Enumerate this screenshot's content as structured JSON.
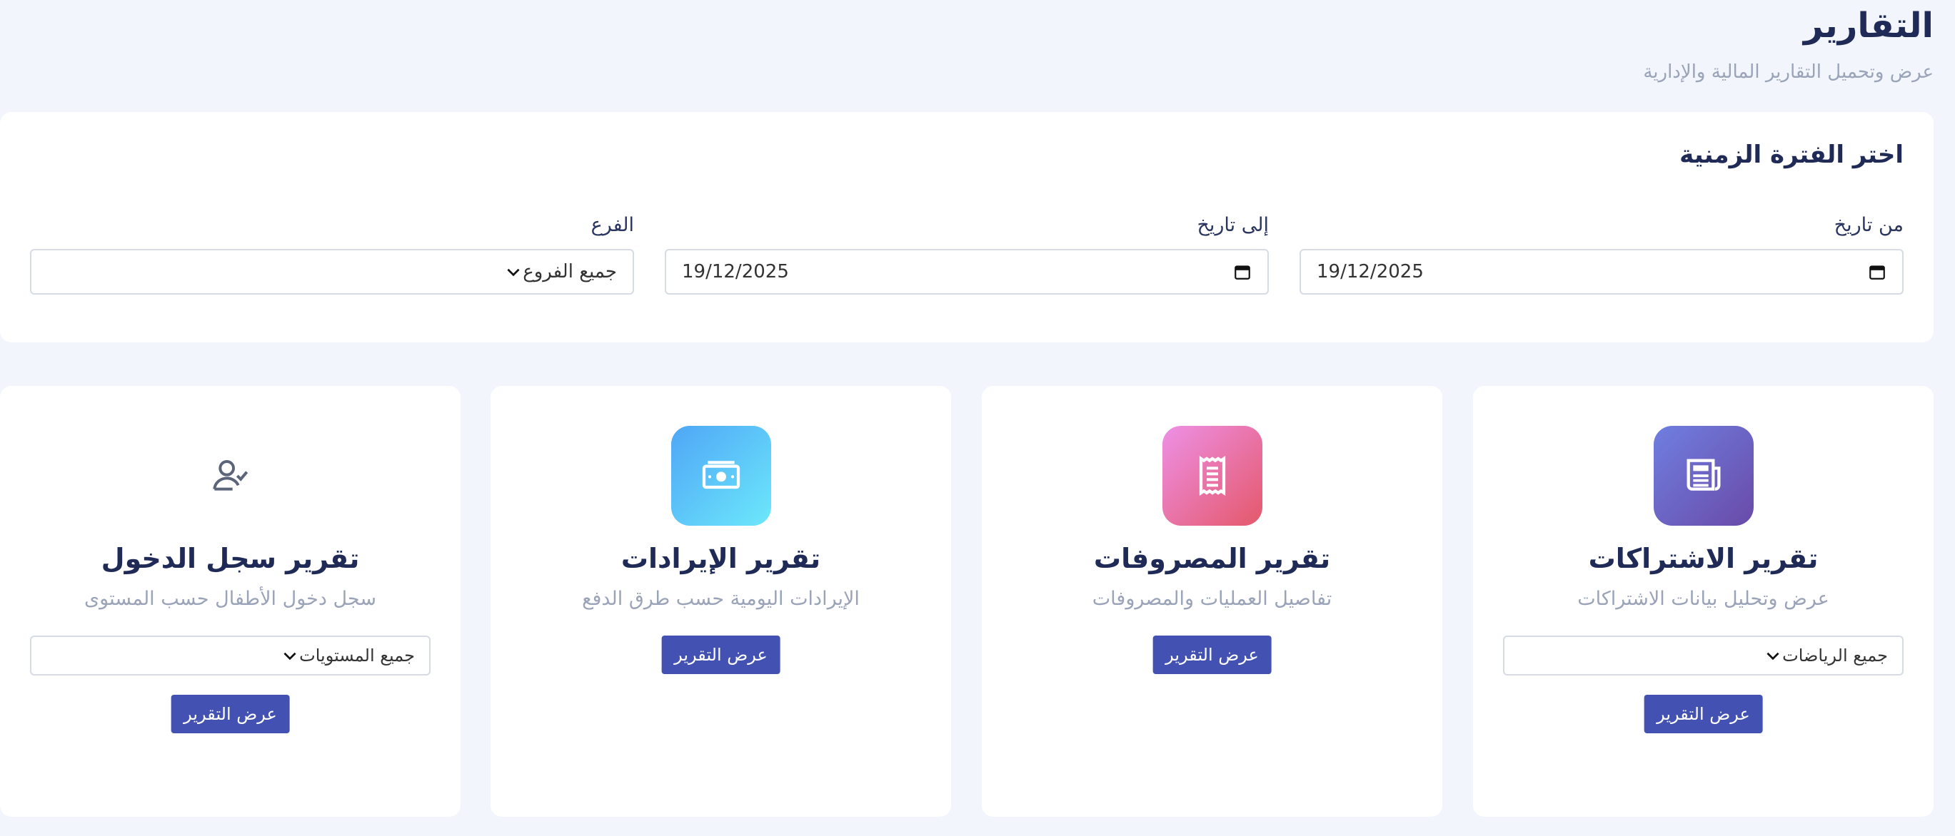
{
  "header": {
    "title": "التقارير",
    "subtitle": "عرض وتحميل التقارير المالية والإدارية"
  },
  "filters": {
    "title": "اختر الفترة الزمنية",
    "from_label": "من تاريخ",
    "from_value": "19/12/2025",
    "to_label": "إلى تاريخ",
    "to_value": "19/12/2025",
    "branch_label": "الفرع",
    "branch_value": "جميع الفروع"
  },
  "cards": [
    {
      "title": "تقرير الاشتراكات",
      "desc": "عرض وتحليل بيانات الاشتراكات",
      "select_value": "جميع الرياضات",
      "button": "عرض التقرير",
      "icon": "newspaper-icon",
      "gradient": [
        "#6f7fe0",
        "#6a4aa8"
      ]
    },
    {
      "title": "تقرير المصروفات",
      "desc": "تفاصيل العمليات والمصروفات",
      "button": "عرض التقرير",
      "icon": "receipt-icon",
      "gradient": [
        "#ee90e6",
        "#e4586a"
      ]
    },
    {
      "title": "تقرير الإيرادات",
      "desc": "الإيرادات اليومية حسب طرق الدفع",
      "button": "عرض التقرير",
      "icon": "cash-icon",
      "gradient": [
        "#4fa6f6",
        "#6ce8fb"
      ]
    },
    {
      "title": "تقرير سجل الدخول",
      "desc": "سجل دخول الأطفال حسب المستوى",
      "select_value": "جميع المستويات",
      "button": "عرض التقرير",
      "icon": "user-check-icon"
    }
  ]
}
